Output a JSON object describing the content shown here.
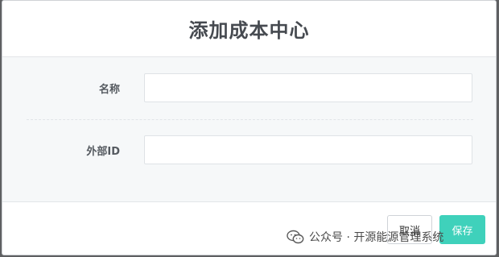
{
  "dialog": {
    "title": "添加成本中心",
    "fields": [
      {
        "label": "名称",
        "value": "",
        "placeholder": ""
      },
      {
        "label": "外部ID",
        "value": "",
        "placeholder": ""
      }
    ],
    "buttons": {
      "cancel_label": "取消",
      "save_label": "保存"
    }
  },
  "watermark": {
    "text": "公众号 · 开源能源管理系统",
    "icon": "wechat-icon"
  },
  "colors": {
    "save_button": "#3fd1bb",
    "overlay": "#5f6062",
    "body_bg": "#f6f8f9"
  }
}
